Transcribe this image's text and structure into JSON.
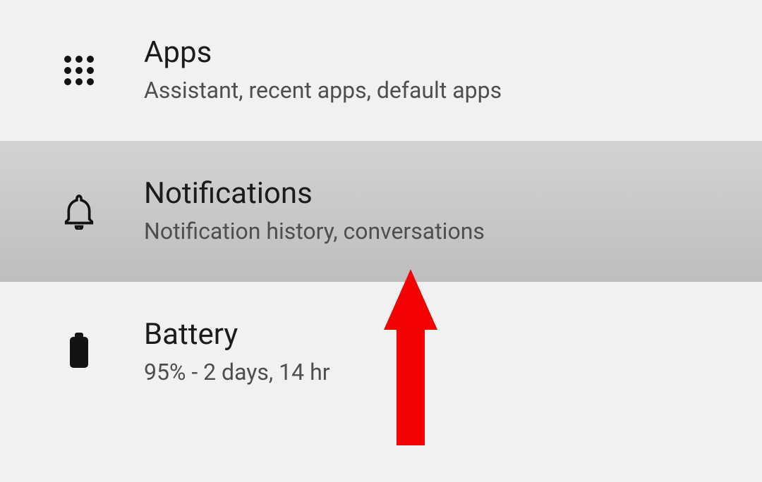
{
  "settings": {
    "items": [
      {
        "icon": "apps-icon",
        "title": "Apps",
        "subtitle": "Assistant, recent apps, default apps",
        "pressed": false
      },
      {
        "icon": "bell-icon",
        "title": "Notifications",
        "subtitle": "Notification history, conversations",
        "pressed": true
      },
      {
        "icon": "battery-icon",
        "title": "Battery",
        "subtitle": "95% - 2 days, 14 hr",
        "pressed": false
      }
    ]
  },
  "annotation": {
    "type": "arrow",
    "color": "#f40102",
    "points_to": "Notifications"
  }
}
